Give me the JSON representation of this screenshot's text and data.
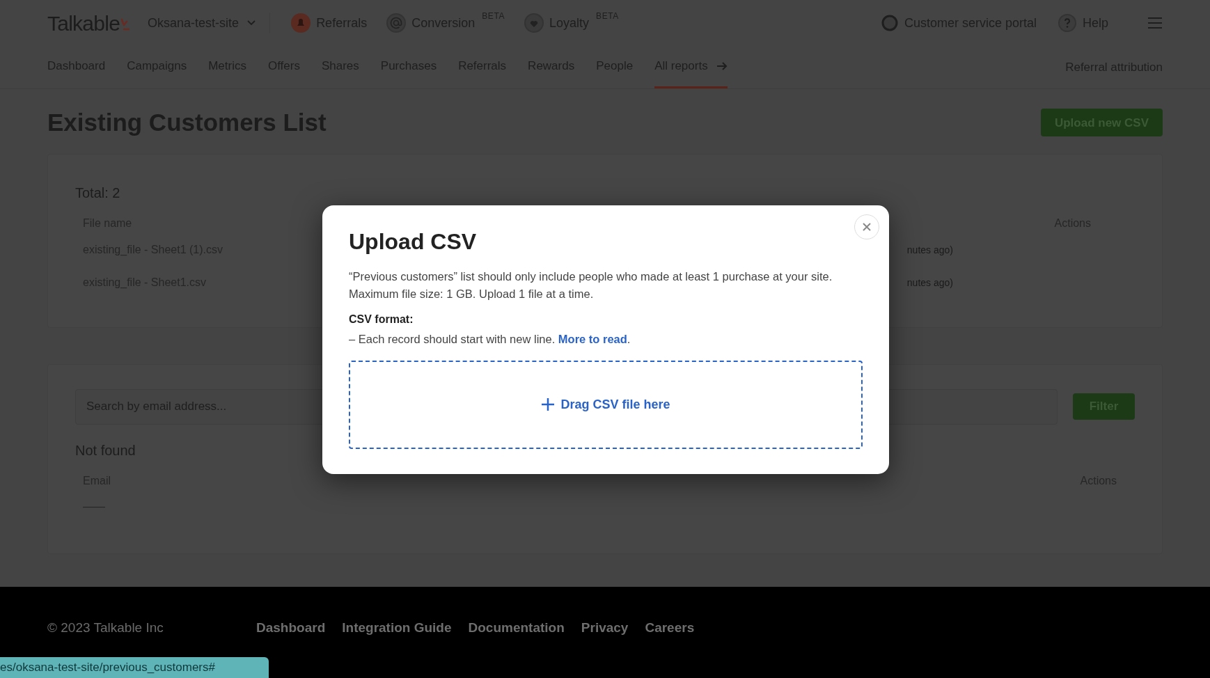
{
  "header": {
    "logo": "Talkable",
    "site": "Oksana-test-site",
    "products": [
      {
        "label": "Referrals",
        "kind": "referrals"
      },
      {
        "label": "Conversion",
        "badge": "BETA",
        "kind": "conversion"
      },
      {
        "label": "Loyalty",
        "badge": "BETA",
        "kind": "loyalty"
      }
    ],
    "links": [
      {
        "label": "Customer service portal",
        "kind": "portal"
      },
      {
        "label": "Help",
        "kind": "help"
      }
    ]
  },
  "nav": {
    "items": [
      {
        "label": "Dashboard",
        "selected": false
      },
      {
        "label": "Campaigns",
        "selected": false
      },
      {
        "label": "Metrics",
        "selected": false
      },
      {
        "label": "Offers",
        "selected": false
      },
      {
        "label": "Shares",
        "selected": false
      },
      {
        "label": "Purchases",
        "selected": false
      },
      {
        "label": "Referrals",
        "selected": false
      },
      {
        "label": "Rewards",
        "selected": false
      },
      {
        "label": "People",
        "selected": false
      },
      {
        "label": "All reports",
        "selected": true
      }
    ],
    "right": "Referral attribution"
  },
  "page": {
    "title": "Existing Customers List",
    "upload_button": "Upload new CSV"
  },
  "files": {
    "total": "Total: 2",
    "columns": [
      "File name",
      "Actions"
    ],
    "rows": [
      {
        "name": "existing_file - Sheet1 (1).csv",
        "time": "nutes ago)"
      },
      {
        "name": "existing_file - Sheet1.csv",
        "time": "nutes ago)"
      }
    ]
  },
  "search": {
    "placeholder": "Search by email address...",
    "button": "Filter",
    "heading": "Not found",
    "columns": [
      "Email",
      "Actions"
    ],
    "empty": "——"
  },
  "footer": {
    "copyright": "© 2023 Talkable Inc",
    "links": [
      "Dashboard",
      "Integration Guide",
      "Documentation",
      "Privacy",
      "Careers"
    ]
  },
  "status_url": "es/oksana-test-site/previous_customers#",
  "modal": {
    "title": "Upload CSV",
    "description": "“Previous customers” list should only include people who made at least 1 purchase at your site. Maximum file size: 1 GB. Upload 1 file at a time.",
    "format_heading": "CSV format:",
    "format_line": "– Each record should start with new line.",
    "link": "More to read",
    "link_end": ".",
    "dropzone": "Drag CSV file here"
  }
}
